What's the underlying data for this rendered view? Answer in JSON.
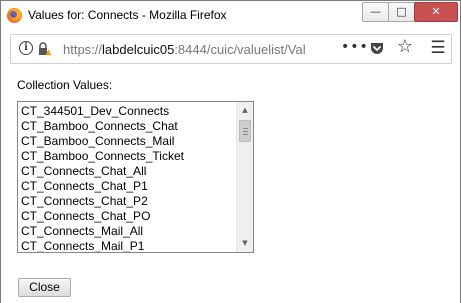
{
  "window": {
    "title": "Values for: Connects - Mozilla Firefox",
    "min_glyph": "—",
    "max_glyph": "□",
    "close_glyph": "✕"
  },
  "urlbar": {
    "url_prefix": "https://",
    "url_host": "labdelcuic05",
    "url_rest": ":8444/cuic/valuelist/Val",
    "more_glyph": "•••",
    "star_glyph": "☆",
    "menu_glyph": "☰",
    "info_glyph": "i",
    "icons": [
      "info-icon",
      "lock-warning-icon",
      "more-icon",
      "pocket-icon",
      "bookmark-star-icon",
      "hamburger-menu-icon"
    ]
  },
  "main": {
    "collection_label": "Collection Values:",
    "items": [
      "CT_344501_Dev_Connects",
      "CT_Bamboo_Connects_Chat",
      "CT_Bamboo_Connects_Mail",
      "CT_Bamboo_Connects_Ticket",
      "CT_Connects_Chat_All",
      "CT_Connects_Chat_P1",
      "CT_Connects_Chat_P2",
      "CT_Connects_Chat_PO",
      "CT_Connects_Mail_All",
      "CT_Connects_Mail_P1"
    ],
    "scroll_up_glyph": "▲",
    "scroll_down_glyph": "▼",
    "close_button": "Close"
  },
  "colors": {
    "close_window_button": "#c75050",
    "lock_warning": "#f5b400"
  }
}
